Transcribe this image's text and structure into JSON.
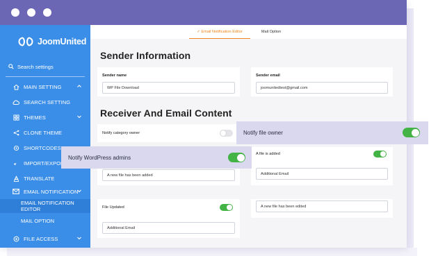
{
  "brand": {
    "name": "JoomUnited"
  },
  "sidebar": {
    "search_label": "Search settings",
    "items": [
      {
        "label": "MAIN SETTING",
        "icon": "home-icon",
        "chevron": "up"
      },
      {
        "label": "SEARCH SETTING",
        "icon": "cloud-icon"
      },
      {
        "label": "THEMES",
        "icon": "grid-icon",
        "chevron": "down"
      },
      {
        "label": "CLONE THEME",
        "icon": "share-icon"
      },
      {
        "label": "SHORTCODES",
        "icon": "gear-icon"
      },
      {
        "label": "IMPORT/EXPORT",
        "icon": "transfer-icon"
      },
      {
        "label": "TRANSLATE",
        "icon": "translate-icon"
      },
      {
        "label": "EMAIL NOTIFICATION",
        "icon": "mail-icon",
        "chevron": "down"
      },
      {
        "label": "FILE ACCESS",
        "icon": "access-icon",
        "chevron": "down"
      }
    ],
    "subitems": [
      {
        "label": "EMAIL NOTIFICATION EDITOR",
        "active": true
      },
      {
        "label": "MAIL OPTION",
        "active": false
      }
    ]
  },
  "tabs": [
    {
      "label": "✓ Email Notification Editor",
      "active": true
    },
    {
      "label": "Mail Option",
      "active": false
    }
  ],
  "sender": {
    "title": "Sender Information",
    "name_label": "Sender name",
    "name_value": "WP File Download",
    "email_label": "Sender email",
    "email_value": "joomunitedtest@gmail.com"
  },
  "receiver": {
    "title": "Receiver And Email Content",
    "notify_category_owner": "Notify category owner",
    "file_added_label": "A file is added",
    "file_added_subject": "A new file has been added",
    "additional_email_placeholder": "Additional Email",
    "file_updated_label": "File Updated",
    "file_edited_subject": "A new file has been edited"
  },
  "callouts": {
    "file_owner": "Notify file owner",
    "wp_admins": "Notify WordPress admins"
  },
  "colors": {
    "titlebar": "#6c67b5",
    "sidebar": "#3b8ee8",
    "accent_tab": "#f0841a",
    "toggle_on": "#43b346",
    "callout": "#d9d8ef"
  }
}
